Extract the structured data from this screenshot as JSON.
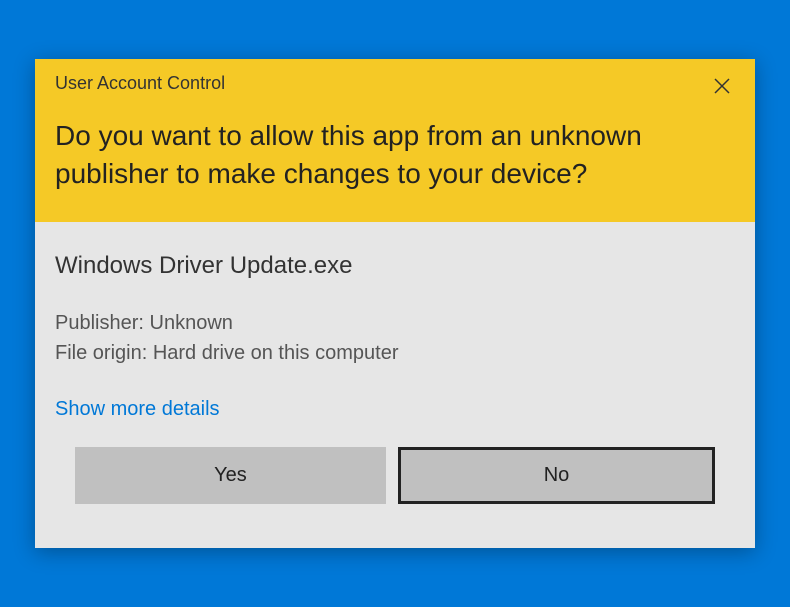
{
  "header": {
    "title": "User Account Control",
    "question": "Do you want to allow this app from an unknown publisher to make changes to your device?"
  },
  "body": {
    "app_name": "Windows Driver Update.exe",
    "publisher_label": "Publisher: ",
    "publisher_value": "Unknown",
    "origin_label": "File origin: ",
    "origin_value": "Hard drive on this computer",
    "show_more": "Show more details"
  },
  "buttons": {
    "yes": "Yes",
    "no": "No"
  }
}
